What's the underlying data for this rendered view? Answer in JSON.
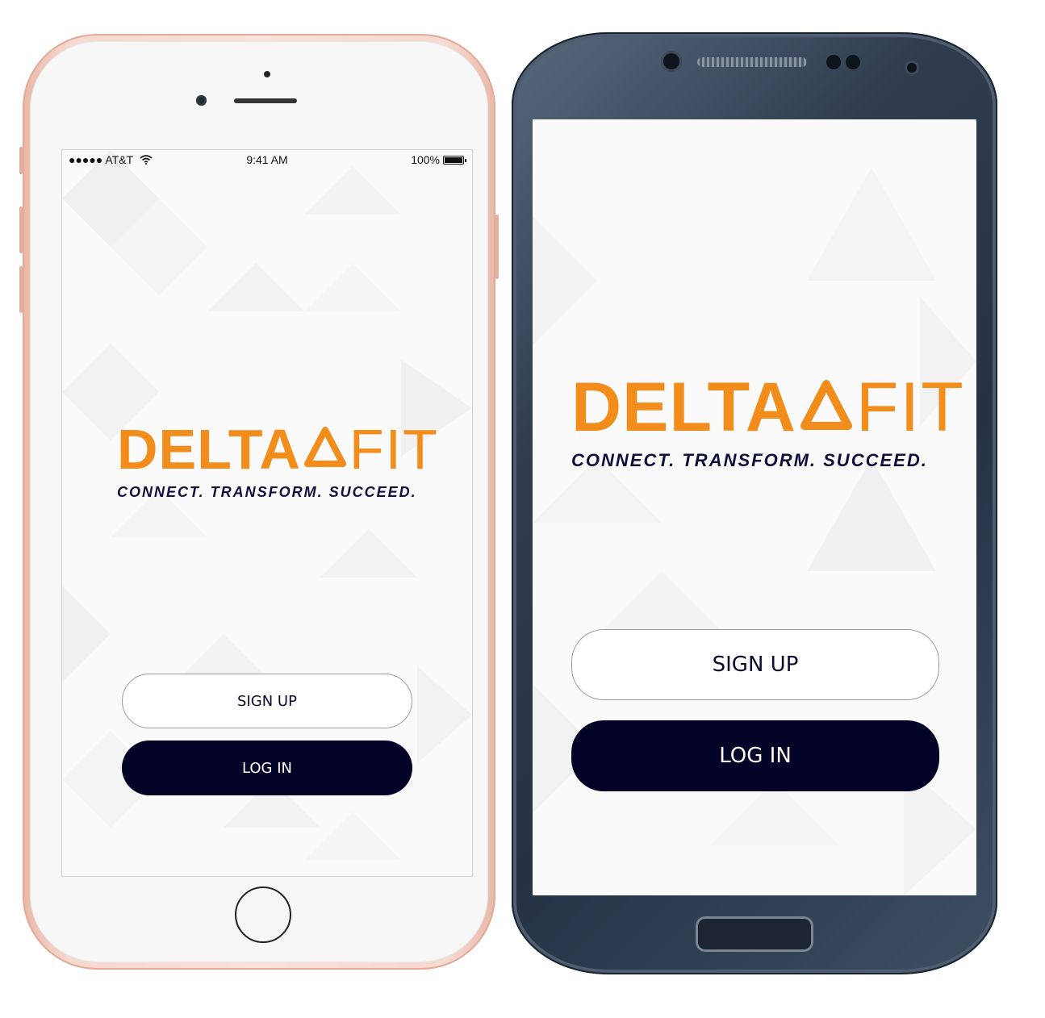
{
  "status_bar": {
    "carrier": "●●●●● AT&T",
    "time": "9:41 AM",
    "battery": "100%",
    "battery_level": 1.0
  },
  "app": {
    "logo_delta": "DELTA",
    "logo_fit": "FIT",
    "tagline": "CONNECT. TRANSFORM. SUCCEED."
  },
  "buttons": {
    "signup_label": "SIGN UP",
    "login_label": "LOG IN"
  },
  "colors": {
    "brand_orange": "#f28c1b",
    "brand_navy": "#030327",
    "iphone_body": "#f6d9cf",
    "android_body": "#2f3d4f"
  },
  "icons": [
    "wifi-icon",
    "battery-icon"
  ]
}
